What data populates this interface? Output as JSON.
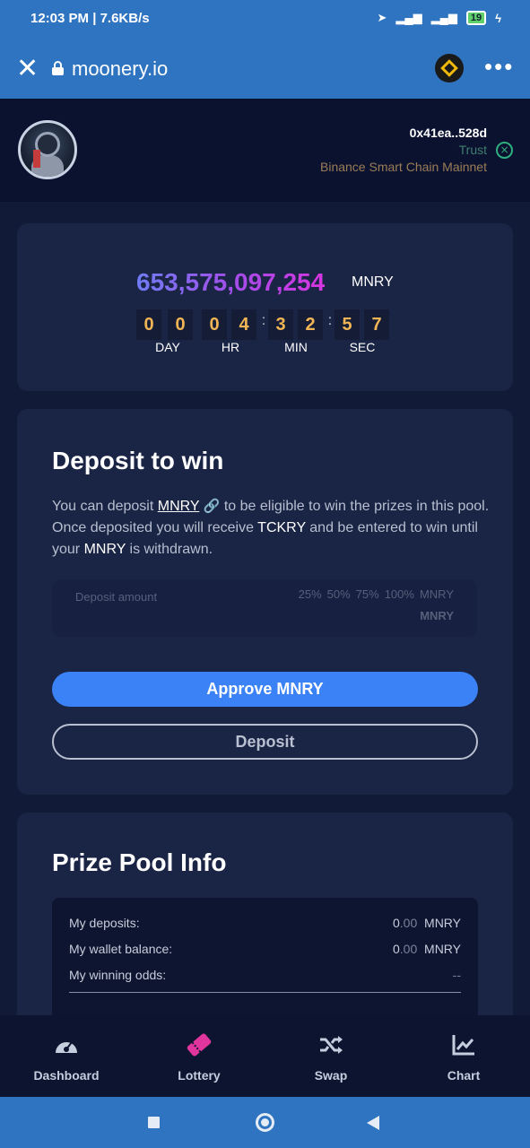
{
  "status_bar": {
    "left_text": "12:03 PM | 7.6KB/s",
    "battery": "19"
  },
  "browser": {
    "close_glyph": "✕",
    "url": "moonery.io",
    "menu_glyph": "•••"
  },
  "account": {
    "address": "0x41ea..528d",
    "wallet": "Trust",
    "network": "Binance Smart Chain Mainnet",
    "disconnect_glyph": "×"
  },
  "prize": {
    "amount": "653,575,097,254",
    "unit": "MNRY",
    "countdown_digits": [
      "0",
      "0",
      "0",
      "4",
      "3",
      "2",
      "5",
      "7"
    ],
    "labels": [
      "DAY",
      "HR",
      "MIN",
      "SEC"
    ]
  },
  "deposit": {
    "title": "Deposit to win",
    "desc_part1": "You can deposit ",
    "desc_link": "MNRY",
    "desc_part2": " to be eligible to win the prizes in this pool. Once deposited you will receive ",
    "desc_ticket": "TCKRY",
    "desc_part3": " and be entered to win until your ",
    "desc_token": "MNRY",
    "desc_part4": " is withdrawn.",
    "input_placeholder": "Deposit amount",
    "pct_options": [
      "25%",
      "50%",
      "75%",
      "100%"
    ],
    "pct_unit": "MNRY",
    "input_unit": "MNRY",
    "approve_label": "Approve MNRY",
    "deposit_label": "Deposit"
  },
  "info": {
    "title": "Prize Pool Info",
    "rows": [
      {
        "label": "My deposits:",
        "int": "0",
        "dec": ".00",
        "unit": "MNRY"
      },
      {
        "label": "My wallet balance:",
        "int": "0",
        "dec": ".00",
        "unit": "MNRY"
      },
      {
        "label": "My winning odds:",
        "value": "--"
      }
    ]
  },
  "nav": {
    "items": [
      {
        "label": "Dashboard",
        "icon": "dashboard-icon"
      },
      {
        "label": "Lottery",
        "icon": "ticket-icon"
      },
      {
        "label": "Swap",
        "icon": "shuffle-icon"
      },
      {
        "label": "Chart",
        "icon": "chart-icon"
      }
    ],
    "active": "Lottery"
  },
  "colors": {
    "accent": "#3b82f6",
    "countdown": "#f1b555",
    "lottery_icon": "#e0359c",
    "browser_bar": "#2f74c0"
  }
}
